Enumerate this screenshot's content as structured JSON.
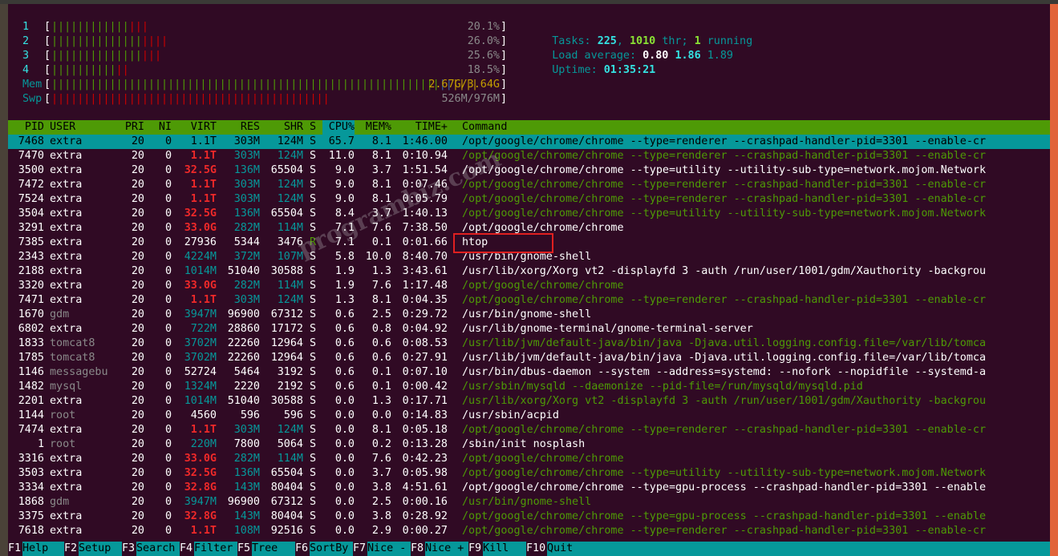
{
  "meters": {
    "cpu": [
      {
        "label": "1",
        "bars_green": "||||||||||||",
        "bars_red": "|||",
        "bars_blue": "",
        "value": "20.1%"
      },
      {
        "label": "2",
        "bars_green": "||||||||||||||",
        "bars_red": "||||",
        "bars_blue": "",
        "value": "26.0%"
      },
      {
        "label": "3",
        "bars_green": "||||||||||||||",
        "bars_red": "|||",
        "bars_blue": "",
        "value": "25.6%"
      },
      {
        "label": "4",
        "bars_green": "||||||||||",
        "bars_red": "||",
        "bars_blue": "",
        "value": "18.5%"
      }
    ],
    "mem": {
      "label": "Mem",
      "bars_green": "||||||||||||||||||||||||||||||||||||||||||||||||||||||||||||",
      "bars_blue": "||",
      "bars_yellow": "||||",
      "value": "2.67G/3.64G"
    },
    "swp": {
      "label": "Swp",
      "bars_red": "|||||||||||||||||||||||||||||||||||||||||||",
      "value": "526M/976M"
    }
  },
  "summary": {
    "tasks_label": "Tasks:",
    "tasks": "225",
    "sep1": ",",
    "threads": "1010",
    "thr_label": "thr;",
    "running": "1",
    "running_label": "running",
    "load_label": "Load average:",
    "load1": "0.80",
    "load5": "1.86",
    "load15": "1.89",
    "uptime_label": "Uptime:",
    "uptime": "01:35:21"
  },
  "columns": {
    "pid": "PID",
    "user": "USER",
    "pri": "PRI",
    "ni": "NI",
    "virt": "VIRT",
    "res": "RES",
    "shr": "SHR",
    "s": "S",
    "cpu": "CPU%",
    "mem": "MEM%",
    "time": "TIME+",
    "command": "Command"
  },
  "processes": [
    {
      "pid": "7468",
      "user": "extra",
      "pri": "20",
      "ni": "0",
      "virt": "1.1T",
      "res": "303M",
      "shr": "124M",
      "s": "S",
      "cpu": "65.7",
      "mem": "8.1",
      "time": "1:46.00",
      "command": "/opt/google/chrome/chrome --type=renderer --crashpad-handler-pid=3301 --enable-cr"
    },
    {
      "pid": "7470",
      "user": "extra",
      "pri": "20",
      "ni": "0",
      "virt": "1.1T",
      "res": "303M",
      "shr": "124M",
      "s": "S",
      "cpu": "11.0",
      "mem": "8.1",
      "time": "0:10.94",
      "command": "/opt/google/chrome/chrome --type=renderer --crashpad-handler-pid=3301 --enable-cr"
    },
    {
      "pid": "3500",
      "user": "extra",
      "pri": "20",
      "ni": "0",
      "virt": "32.5G",
      "res": "136M",
      "shr": "65504",
      "s": "S",
      "cpu": "9.0",
      "mem": "3.7",
      "time": "1:51.54",
      "command": "/opt/google/chrome/chrome --type=utility --utility-sub-type=network.mojom.Network"
    },
    {
      "pid": "7472",
      "user": "extra",
      "pri": "20",
      "ni": "0",
      "virt": "1.1T",
      "res": "303M",
      "shr": "124M",
      "s": "S",
      "cpu": "9.0",
      "mem": "8.1",
      "time": "0:07.46",
      "command": "/opt/google/chrome/chrome --type=renderer --crashpad-handler-pid=3301 --enable-cr"
    },
    {
      "pid": "7524",
      "user": "extra",
      "pri": "20",
      "ni": "0",
      "virt": "1.1T",
      "res": "303M",
      "shr": "124M",
      "s": "S",
      "cpu": "9.0",
      "mem": "8.1",
      "time": "0:05.79",
      "command": "/opt/google/chrome/chrome --type=renderer --crashpad-handler-pid=3301 --enable-cr"
    },
    {
      "pid": "3504",
      "user": "extra",
      "pri": "20",
      "ni": "0",
      "virt": "32.5G",
      "res": "136M",
      "shr": "65504",
      "s": "S",
      "cpu": "8.4",
      "mem": "3.7",
      "time": "1:40.13",
      "command": "/opt/google/chrome/chrome --type=utility --utility-sub-type=network.mojom.Network"
    },
    {
      "pid": "3291",
      "user": "extra",
      "pri": "20",
      "ni": "0",
      "virt": "33.0G",
      "res": "282M",
      "shr": "114M",
      "s": "S",
      "cpu": "7.1",
      "mem": "7.6",
      "time": "7:38.50",
      "command": "/opt/google/chrome/chrome"
    },
    {
      "pid": "7385",
      "user": "extra",
      "pri": "20",
      "ni": "0",
      "virt": "27936",
      "res": "5344",
      "shr": "3476",
      "s": "R",
      "cpu": "7.1",
      "mem": "0.1",
      "time": "0:01.66",
      "command": "htop"
    },
    {
      "pid": "2343",
      "user": "extra",
      "pri": "20",
      "ni": "0",
      "virt": "4224M",
      "res": "372M",
      "shr": "107M",
      "s": "S",
      "cpu": "5.8",
      "mem": "10.0",
      "time": "8:40.70",
      "command": "/usr/bin/gnome-shell"
    },
    {
      "pid": "2188",
      "user": "extra",
      "pri": "20",
      "ni": "0",
      "virt": "1014M",
      "res": "51040",
      "shr": "30588",
      "s": "S",
      "cpu": "1.9",
      "mem": "1.3",
      "time": "3:43.61",
      "command": "/usr/lib/xorg/Xorg vt2 -displayfd 3 -auth /run/user/1001/gdm/Xauthority -backgrou"
    },
    {
      "pid": "3320",
      "user": "extra",
      "pri": "20",
      "ni": "0",
      "virt": "33.0G",
      "res": "282M",
      "shr": "114M",
      "s": "S",
      "cpu": "1.9",
      "mem": "7.6",
      "time": "1:17.48",
      "command": "/opt/google/chrome/chrome"
    },
    {
      "pid": "7471",
      "user": "extra",
      "pri": "20",
      "ni": "0",
      "virt": "1.1T",
      "res": "303M",
      "shr": "124M",
      "s": "S",
      "cpu": "1.3",
      "mem": "8.1",
      "time": "0:04.35",
      "command": "/opt/google/chrome/chrome --type=renderer --crashpad-handler-pid=3301 --enable-cr"
    },
    {
      "pid": "1670",
      "user": "gdm",
      "pri": "20",
      "ni": "0",
      "virt": "3947M",
      "res": "96900",
      "shr": "67312",
      "s": "S",
      "cpu": "0.6",
      "mem": "2.5",
      "time": "0:29.72",
      "command": "/usr/bin/gnome-shell"
    },
    {
      "pid": "6802",
      "user": "extra",
      "pri": "20",
      "ni": "0",
      "virt": "722M",
      "res": "28860",
      "shr": "17172",
      "s": "S",
      "cpu": "0.6",
      "mem": "0.8",
      "time": "0:04.92",
      "command": "/usr/lib/gnome-terminal/gnome-terminal-server"
    },
    {
      "pid": "1833",
      "user": "tomcat8",
      "pri": "20",
      "ni": "0",
      "virt": "3702M",
      "res": "22260",
      "shr": "12964",
      "s": "S",
      "cpu": "0.6",
      "mem": "0.6",
      "time": "0:08.53",
      "command": "/usr/lib/jvm/default-java/bin/java -Djava.util.logging.config.file=/var/lib/tomca"
    },
    {
      "pid": "1785",
      "user": "tomcat8",
      "pri": "20",
      "ni": "0",
      "virt": "3702M",
      "res": "22260",
      "shr": "12964",
      "s": "S",
      "cpu": "0.6",
      "mem": "0.6",
      "time": "0:27.91",
      "command": "/usr/lib/jvm/default-java/bin/java -Djava.util.logging.config.file=/var/lib/tomca"
    },
    {
      "pid": "1146",
      "user": "messagebu",
      "pri": "20",
      "ni": "0",
      "virt": "52724",
      "res": "5464",
      "shr": "3192",
      "s": "S",
      "cpu": "0.6",
      "mem": "0.1",
      "time": "0:07.10",
      "command": "/usr/bin/dbus-daemon --system --address=systemd: --nofork --nopidfile --systemd-a"
    },
    {
      "pid": "1482",
      "user": "mysql",
      "pri": "20",
      "ni": "0",
      "virt": "1324M",
      "res": "2220",
      "shr": "2192",
      "s": "S",
      "cpu": "0.6",
      "mem": "0.1",
      "time": "0:00.42",
      "command": "/usr/sbin/mysqld --daemonize --pid-file=/run/mysqld/mysqld.pid"
    },
    {
      "pid": "2201",
      "user": "extra",
      "pri": "20",
      "ni": "0",
      "virt": "1014M",
      "res": "51040",
      "shr": "30588",
      "s": "S",
      "cpu": "0.0",
      "mem": "1.3",
      "time": "0:17.71",
      "command": "/usr/lib/xorg/Xorg vt2 -displayfd 3 -auth /run/user/1001/gdm/Xauthority -backgrou"
    },
    {
      "pid": "1144",
      "user": "root",
      "pri": "20",
      "ni": "0",
      "virt": "4560",
      "res": "596",
      "shr": "596",
      "s": "S",
      "cpu": "0.0",
      "mem": "0.0",
      "time": "0:14.83",
      "command": "/usr/sbin/acpid"
    },
    {
      "pid": "7474",
      "user": "extra",
      "pri": "20",
      "ni": "0",
      "virt": "1.1T",
      "res": "303M",
      "shr": "124M",
      "s": "S",
      "cpu": "0.0",
      "mem": "8.1",
      "time": "0:05.18",
      "command": "/opt/google/chrome/chrome --type=renderer --crashpad-handler-pid=3301 --enable-cr"
    },
    {
      "pid": "1",
      "user": "root",
      "pri": "20",
      "ni": "0",
      "virt": "220M",
      "res": "7800",
      "shr": "5064",
      "s": "S",
      "cpu": "0.0",
      "mem": "0.2",
      "time": "0:13.28",
      "command": "/sbin/init nosplash"
    },
    {
      "pid": "3316",
      "user": "extra",
      "pri": "20",
      "ni": "0",
      "virt": "33.0G",
      "res": "282M",
      "shr": "114M",
      "s": "S",
      "cpu": "0.0",
      "mem": "7.6",
      "time": "0:42.23",
      "command": "/opt/google/chrome/chrome"
    },
    {
      "pid": "3503",
      "user": "extra",
      "pri": "20",
      "ni": "0",
      "virt": "32.5G",
      "res": "136M",
      "shr": "65504",
      "s": "S",
      "cpu": "0.0",
      "mem": "3.7",
      "time": "0:05.98",
      "command": "/opt/google/chrome/chrome --type=utility --utility-sub-type=network.mojom.Network"
    },
    {
      "pid": "3334",
      "user": "extra",
      "pri": "20",
      "ni": "0",
      "virt": "32.8G",
      "res": "143M",
      "shr": "80404",
      "s": "S",
      "cpu": "0.0",
      "mem": "3.8",
      "time": "4:51.61",
      "command": "/opt/google/chrome/chrome --type=gpu-process --crashpad-handler-pid=3301 --enable"
    },
    {
      "pid": "1868",
      "user": "gdm",
      "pri": "20",
      "ni": "0",
      "virt": "3947M",
      "res": "96900",
      "shr": "67312",
      "s": "S",
      "cpu": "0.0",
      "mem": "2.5",
      "time": "0:00.16",
      "command": "/usr/bin/gnome-shell"
    },
    {
      "pid": "3375",
      "user": "extra",
      "pri": "20",
      "ni": "0",
      "virt": "32.8G",
      "res": "143M",
      "shr": "80404",
      "s": "S",
      "cpu": "0.0",
      "mem": "3.8",
      "time": "0:28.92",
      "command": "/opt/google/chrome/chrome --type=gpu-process --crashpad-handler-pid=3301 --enable"
    },
    {
      "pid": "7618",
      "user": "extra",
      "pri": "20",
      "ni": "0",
      "virt": "1.1T",
      "res": "108M",
      "shr": "92516",
      "s": "S",
      "cpu": "0.0",
      "mem": "2.9",
      "time": "0:00.27",
      "command": "/opt/google/chrome/chrome --type=renderer --crashpad-handler-pid=3301 --enable-cr"
    }
  ],
  "function_keys": [
    {
      "key": "F1",
      "label": "Help"
    },
    {
      "key": "F2",
      "label": "Setup"
    },
    {
      "key": "F3",
      "label": "Search"
    },
    {
      "key": "F4",
      "label": "Filter"
    },
    {
      "key": "F5",
      "label": "Tree"
    },
    {
      "key": "F6",
      "label": "SortBy"
    },
    {
      "key": "F7",
      "label": "Nice -"
    },
    {
      "key": "F8",
      "label": "Nice +"
    },
    {
      "key": "F9",
      "label": "Kill"
    },
    {
      "key": "F10",
      "label": "Quit"
    }
  ],
  "watermark": "programbiz.com",
  "colors": {
    "header_bg": "#4e9a06",
    "selected_bg": "#06989a",
    "terminal_bg": "#300a24",
    "thread_green": "#4e9a06",
    "large_red": "#ef2929"
  }
}
